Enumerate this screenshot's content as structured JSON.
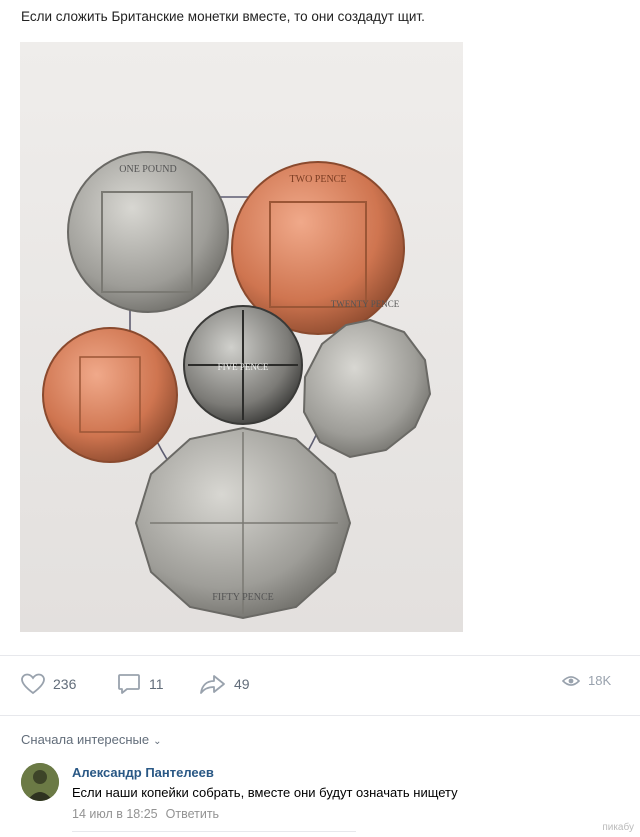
{
  "post": {
    "text": "Если сложить Британские монетки вместе, то они создадут щит."
  },
  "photo": {
    "coins": {
      "one_pound": "ONE POUND",
      "two_pence": "TWO PENCE",
      "five_pence": "FIVE PENCE",
      "twenty_pence": "TWENTY PENCE",
      "fifty_pence": "FIFTY PENCE"
    }
  },
  "actions": {
    "likes": "236",
    "comments": "11",
    "shares": "49",
    "views": "18K"
  },
  "comments": {
    "sort_label": "Сначала интересные",
    "items": [
      {
        "author": "Александр Пантелеев",
        "text": "Если наши копейки собрать, вместе они будут означать нищету",
        "time": "14 июл в 18:25",
        "reply_label": "Ответить"
      }
    ]
  },
  "watermark": "пикабу",
  "colors": {
    "link": "#2a5885",
    "muted": "#626d7a",
    "copper": "#c4774a",
    "silver": "#a9a8a3"
  }
}
